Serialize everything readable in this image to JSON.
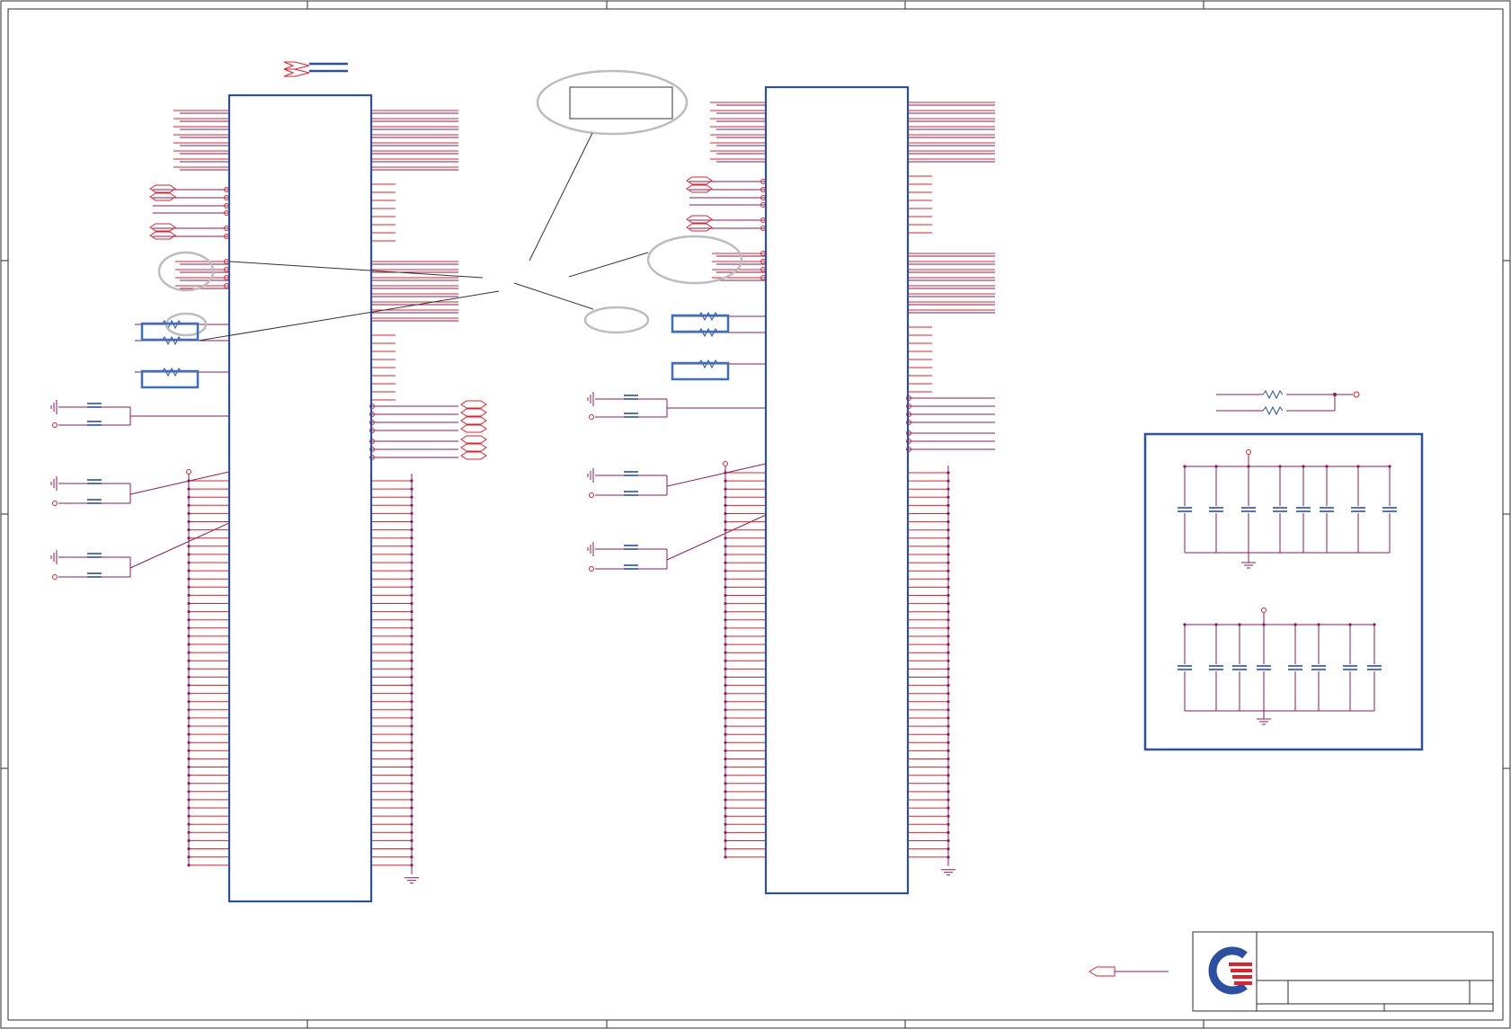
{
  "sheet": {
    "title": "",
    "colors": {
      "wire": "#e0202a",
      "net": "#8b1a5a",
      "component": "#2a4fa3",
      "frame": "#2b2b2b",
      "annotation": "#bdbdbd",
      "callout_line": "#333333",
      "highlight_box": "#3a6fc4"
    }
  },
  "left_chip": {
    "label": ""
  },
  "right_chip": {
    "label": ""
  },
  "decoupling_block": {
    "label": ""
  },
  "title_block": {
    "logo": "company-logo-icon",
    "title": "",
    "sheet_number": ""
  }
}
